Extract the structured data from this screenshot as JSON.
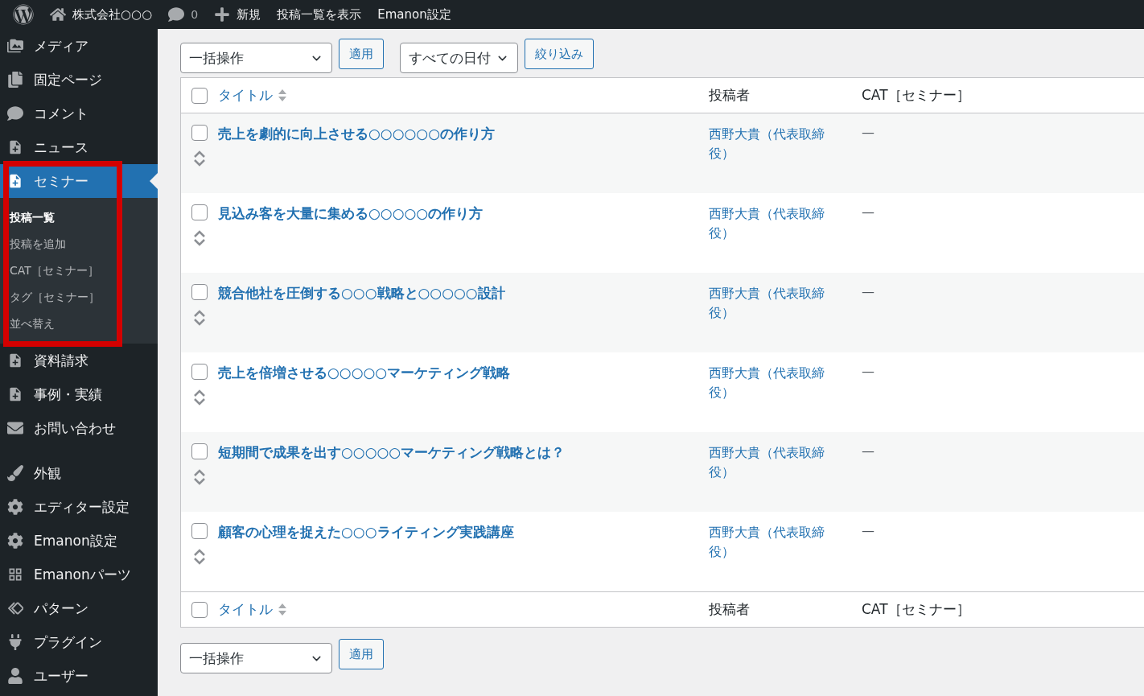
{
  "admin_bar": {
    "items": [
      {
        "kind": "logo"
      },
      {
        "kind": "home",
        "label": "株式会社○○○"
      },
      {
        "kind": "comments",
        "label": "0"
      },
      {
        "kind": "new",
        "label": "新規"
      },
      {
        "kind": "text",
        "label": "投稿一覧を表示"
      },
      {
        "kind": "text",
        "label": "Emanon設定"
      }
    ]
  },
  "sidebar": {
    "items": [
      {
        "kind": "item",
        "label": "メディア",
        "selected": false,
        "highlighted": false
      },
      {
        "kind": "item",
        "label": "固定ページ",
        "selected": false,
        "highlighted": false
      },
      {
        "kind": "item",
        "label": "コメント",
        "selected": false,
        "highlighted": false
      },
      {
        "kind": "item",
        "label": "ニュース",
        "selected": false,
        "highlighted": false
      },
      {
        "kind": "item",
        "label": "セミナー",
        "selected": true,
        "highlighted": true,
        "children": [
          {
            "label": "投稿一覧",
            "selected": true
          },
          {
            "label": "投稿を追加",
            "selected": false
          },
          {
            "label": "CAT［セミナー］",
            "selected": false
          },
          {
            "label": "タグ［セミナー］",
            "selected": false
          },
          {
            "label": "並べ替え",
            "selected": false
          }
        ]
      },
      {
        "kind": "item",
        "label": "資料請求",
        "selected": false,
        "highlighted": false
      },
      {
        "kind": "item",
        "label": "事例・実績",
        "selected": false,
        "highlighted": false
      },
      {
        "kind": "item",
        "label": "お問い合わせ",
        "selected": false,
        "highlighted": false
      },
      {
        "kind": "separator"
      },
      {
        "kind": "item",
        "label": "外観",
        "selected": false,
        "highlighted": false
      },
      {
        "kind": "item",
        "label": "エディター設定",
        "selected": false,
        "highlighted": false
      },
      {
        "kind": "item",
        "label": "Emanon設定",
        "selected": false,
        "highlighted": false
      },
      {
        "kind": "item",
        "label": "Emanonパーツ",
        "selected": false,
        "highlighted": false
      },
      {
        "kind": "item",
        "label": "パターン",
        "selected": false,
        "highlighted": false
      },
      {
        "kind": "item",
        "label": "プラグイン",
        "selected": false,
        "highlighted": false
      },
      {
        "kind": "item",
        "label": "ユーザー",
        "selected": false,
        "highlighted": false
      }
    ]
  },
  "top_actions": {
    "bulk_action": {
      "value": "一括操作"
    },
    "apply": "適用",
    "date_filter": {
      "value": "すべての日付"
    },
    "filter": "絞り込み"
  },
  "table": {
    "header": {
      "checked": false,
      "columns": [
        {
          "kind": "title",
          "label": "タイトル"
        },
        {
          "kind": "author",
          "label": "投稿者"
        },
        {
          "kind": "category",
          "label": "CAT［セミナー］"
        }
      ]
    },
    "rows": [
      {
        "checked": false,
        "title": "売上を劇的に向上させる○○○○○○の作り方",
        "author": "西野大貴（代表取締役）",
        "category": "—"
      },
      {
        "checked": false,
        "title": "見込み客を大量に集める○○○○○の作り方",
        "author": "西野大貴（代表取締役）",
        "category": "—"
      },
      {
        "checked": false,
        "title": "競合他社を圧倒する○○○戦略と○○○○○設計",
        "author": "西野大貴（代表取締役）",
        "category": "—"
      },
      {
        "checked": false,
        "title": "売上を倍増させる○○○○○マーケティング戦略",
        "author": "西野大貴（代表取締役）",
        "category": "—"
      },
      {
        "checked": false,
        "title": "短期間で成果を出す○○○○○マーケティング戦略とは？",
        "author": "西野大貴（代表取締役）",
        "category": "—"
      },
      {
        "checked": false,
        "title": "顧客の心理を捉えた○○○ライティング実践講座",
        "author": "西野大貴（代表取締役）",
        "category": "—"
      }
    ],
    "footer": {
      "checked": false,
      "columns": [
        {
          "kind": "title",
          "label": "タイトル"
        },
        {
          "kind": "author",
          "label": "投稿者"
        },
        {
          "kind": "category",
          "label": "CAT［セミナー］"
        }
      ]
    }
  },
  "bottom_actions": {
    "bulk_action": {
      "value": "一括操作"
    },
    "apply": "適用"
  }
}
